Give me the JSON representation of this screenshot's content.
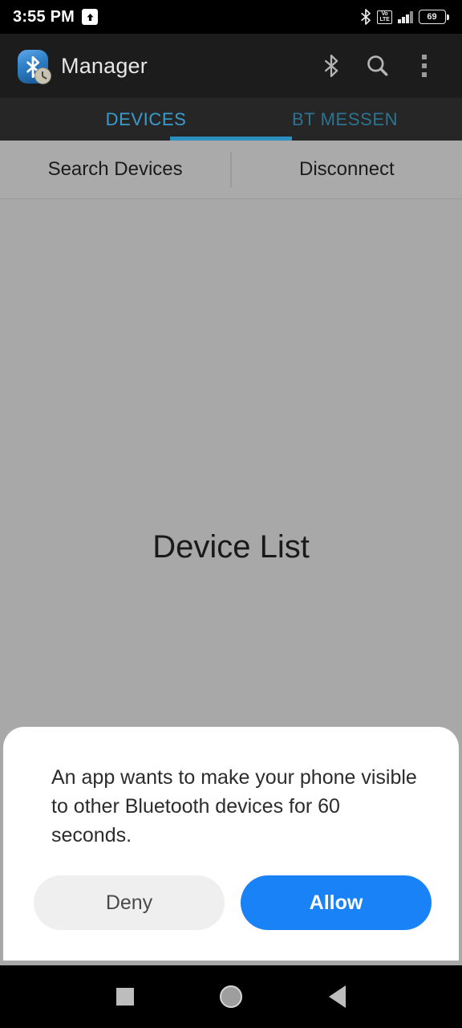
{
  "status_bar": {
    "time": "3:55 PM",
    "upload_icon": "upload-arrow-icon",
    "bluetooth_icon": "bluetooth-icon",
    "network_type_line1": "Vo",
    "network_type_line2": "LTE",
    "signal_icon": "signal-bars-icon",
    "battery_level": "69"
  },
  "app_bar": {
    "app_icon": "bluetooth-clock-app-icon",
    "title": "Manager",
    "bluetooth_icon": "bluetooth-icon",
    "search_icon": "search-icon",
    "overflow_icon": "more-vertical-icon"
  },
  "tabs": {
    "active_index": 0,
    "items": [
      {
        "label": "DEVICES",
        "active": true
      },
      {
        "label": "BT MESSEN",
        "active": false
      }
    ]
  },
  "action_bar": {
    "search_devices_label": "Search Devices",
    "disconnect_label": "Disconnect"
  },
  "content": {
    "device_list_label": "Device List"
  },
  "dialog": {
    "message": "An app wants to make your phone visible to other Bluetooth devices for 60 seconds.",
    "deny_label": "Deny",
    "allow_label": "Allow"
  },
  "nav_bar": {
    "recents_icon": "square-recents-icon",
    "home_icon": "circle-home-icon",
    "back_icon": "triangle-back-icon"
  },
  "colors": {
    "accent_blue": "#1a82f7",
    "tab_active": "#3a9ccd",
    "tab_indicator": "#2b8fc0",
    "appbar_bg": "#1c1c1c",
    "content_bg": "#a8a8a8"
  }
}
